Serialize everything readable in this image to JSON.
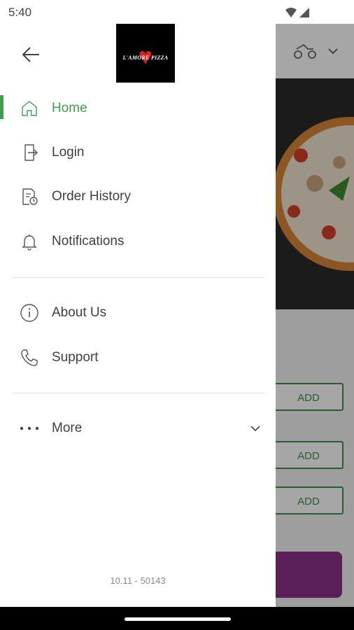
{
  "status_bar": {
    "time": "5:40",
    "icons": [
      "wifi-icon",
      "signal-icon"
    ]
  },
  "drawer": {
    "logo_text": "L'AMORE PIZZA",
    "menu_primary": [
      {
        "label": "Home",
        "icon": "home-icon",
        "active": true
      },
      {
        "label": "Login",
        "icon": "login-icon",
        "active": false
      },
      {
        "label": "Order History",
        "icon": "order-history-icon",
        "active": false
      },
      {
        "label": "Notifications",
        "icon": "bell-icon",
        "active": false
      }
    ],
    "menu_secondary": [
      {
        "label": "About Us",
        "icon": "info-icon"
      },
      {
        "label": "Support",
        "icon": "phone-icon"
      }
    ],
    "more_label": "More",
    "version": "10.11 - 50143"
  },
  "background": {
    "add_buttons": [
      "ADD",
      "ADD",
      "ADD"
    ]
  },
  "colors": {
    "accent_green": "#3f9e4d",
    "cart_purple": "#8a2f88"
  }
}
